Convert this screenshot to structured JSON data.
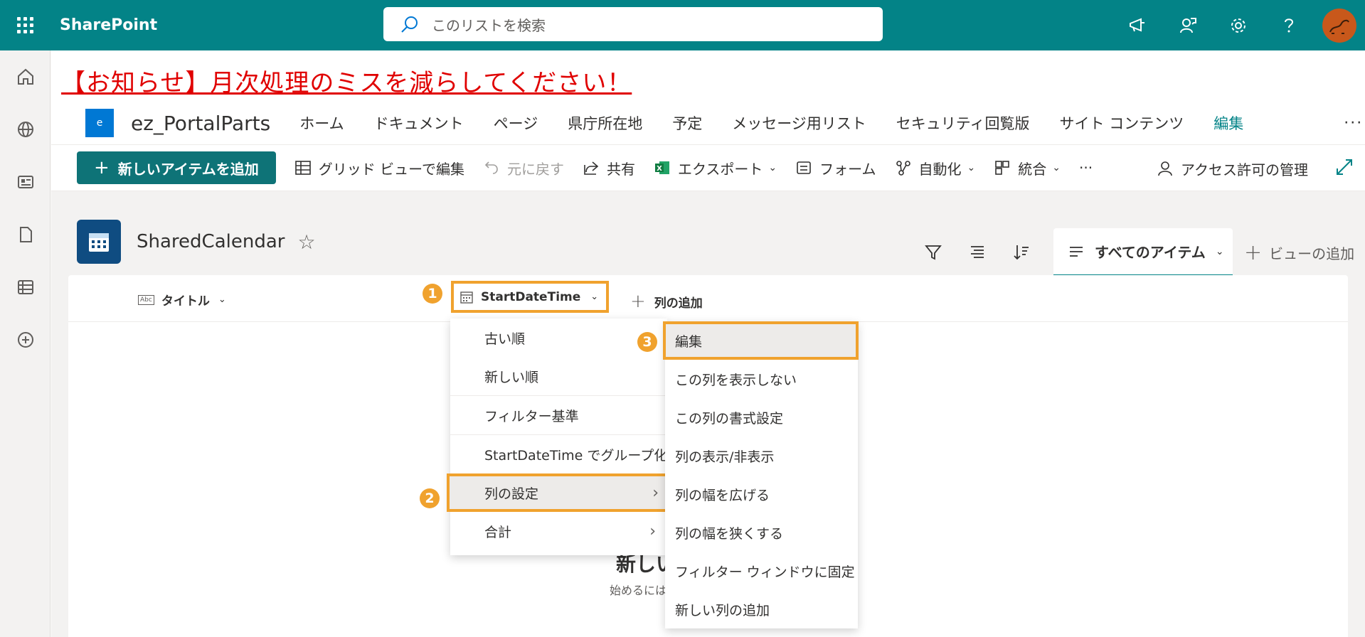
{
  "suite": {
    "brand": "SharePoint",
    "search_placeholder": "このリストを検索"
  },
  "announcement": "【お知らせ】月次処理のミスを減らしてください！",
  "site": {
    "logo_letter": "e",
    "name": "ez_PortalParts",
    "nav": [
      "ホーム",
      "ドキュメント",
      "ページ",
      "県庁所在地",
      "予定",
      "メッセージ用リスト",
      "セキュリティ回覧版",
      "サイト コンテンツ"
    ],
    "nav_edit": "編集",
    "nav_more": "···"
  },
  "commands": {
    "new_item": "新しいアイテムを追加",
    "grid_edit": "グリッド ビューで編集",
    "undo": "元に戻す",
    "share": "共有",
    "export": "エクスポート",
    "form": "フォーム",
    "automate": "自動化",
    "integrate": "統合",
    "more": "···",
    "access": "アクセス許可の管理"
  },
  "list": {
    "title": "SharedCalendar",
    "view_name": "すべてのアイテム",
    "add_view": "ビューの追加"
  },
  "columns": {
    "title": "タイトル",
    "title_type": "Abc",
    "start": "StartDateTime",
    "add": "列の追加"
  },
  "empty": {
    "title": "新しい",
    "subtitle": "始めるには"
  },
  "menu": {
    "items": [
      "古い順",
      "新しい順",
      "フィルター基準",
      "StartDateTime でグループ化",
      "列の設定",
      "合計"
    ]
  },
  "submenu": {
    "items": [
      "編集",
      "この列を表示しない",
      "この列の書式設定",
      "列の表示/非表示",
      "列の幅を広げる",
      "列の幅を狭くする",
      "フィルター ウィンドウに固定",
      "新しい列の追加"
    ]
  },
  "badges": [
    "1",
    "2",
    "3"
  ],
  "colors": {
    "suite_bar": "#038387",
    "primary_button": "#0e7377",
    "highlight": "#f0a22e",
    "announcement": "#e00000"
  }
}
